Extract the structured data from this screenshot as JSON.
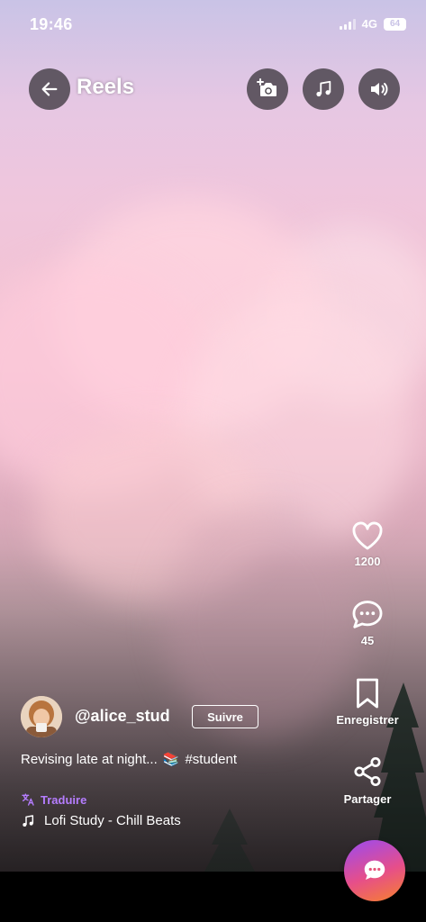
{
  "status_bar": {
    "time": "19:46",
    "network": "4G",
    "battery": "64"
  },
  "header": {
    "title": "Reels",
    "back_icon": "arrow-left-icon",
    "camera_icon": "camera-add-icon",
    "music_icon": "music-note-icon",
    "sound_icon": "speaker-icon"
  },
  "actions": {
    "likes": {
      "icon": "heart-icon",
      "count": "1200"
    },
    "comments": {
      "icon": "comment-icon",
      "count": "45"
    },
    "save": {
      "icon": "bookmark-icon",
      "label": "Enregistrer"
    },
    "share": {
      "icon": "share-icon",
      "label": "Partager"
    }
  },
  "post": {
    "username": "@alice_stud",
    "follow_label": "Suivre",
    "caption": "Revising late at night...",
    "caption_emoji": "📚",
    "hashtag": "#student",
    "translate_label": "Traduire",
    "audio_title": "Lofi Study - Chill Beats"
  },
  "fab": {
    "icon": "chat-bubble-icon"
  },
  "colors": {
    "accent_purple": "#b57dff",
    "fab_gradient_start": "#9a4bf2",
    "fab_gradient_end": "#f7822c"
  }
}
